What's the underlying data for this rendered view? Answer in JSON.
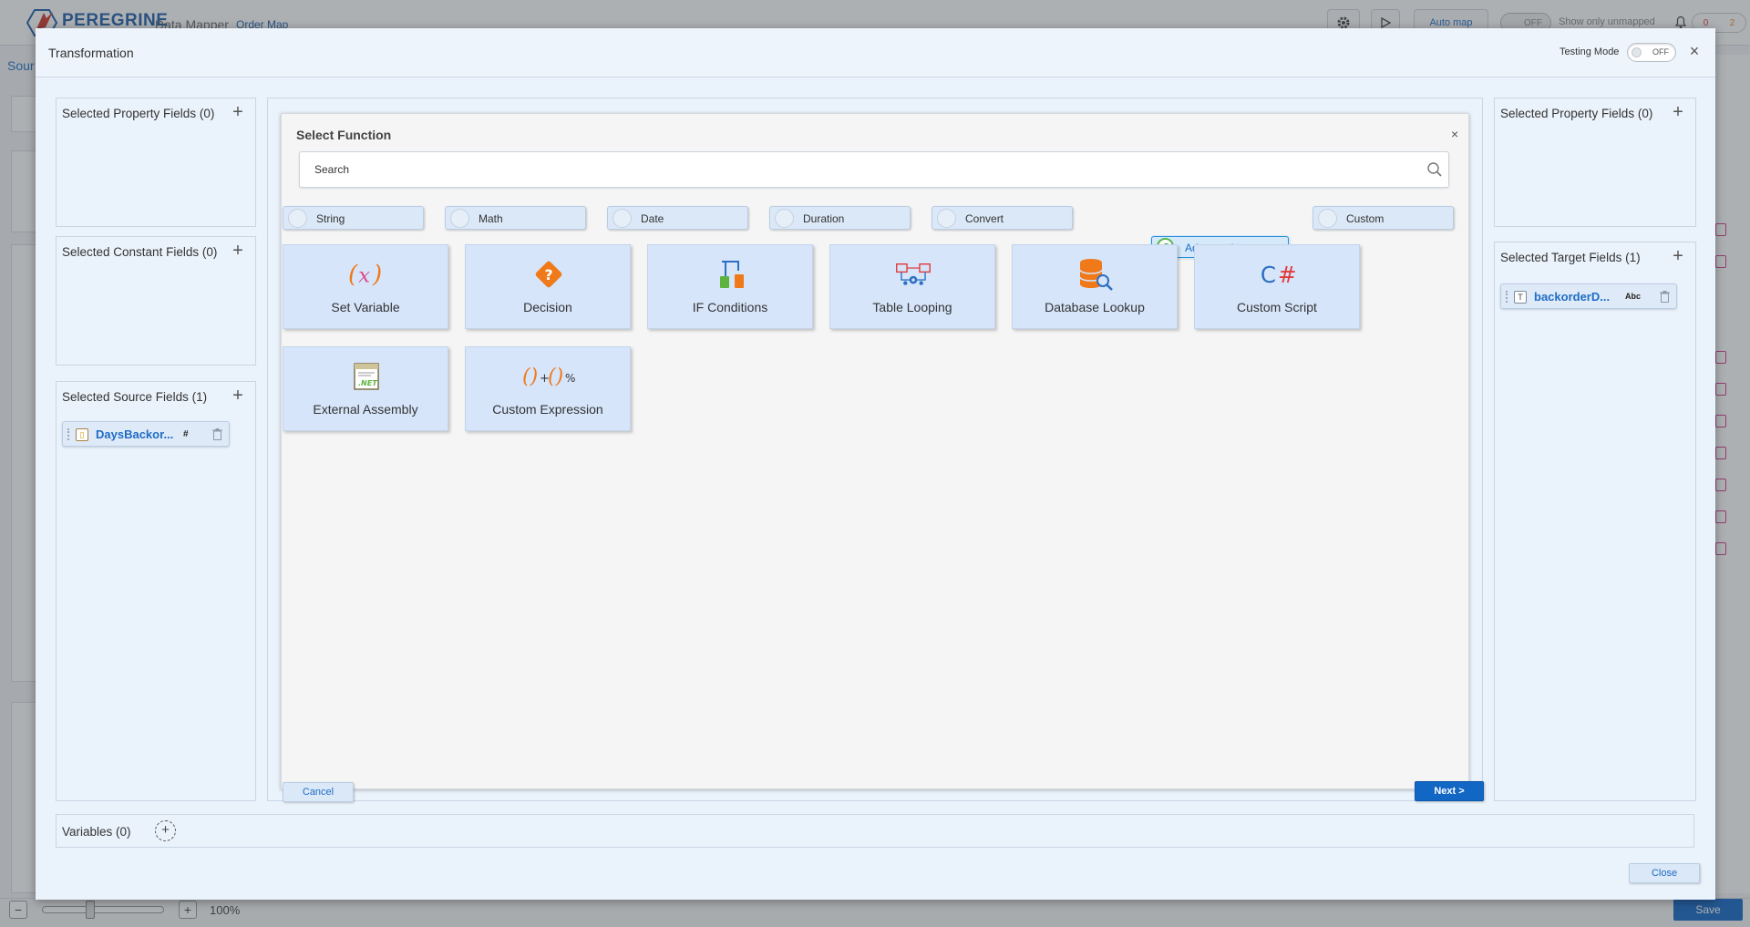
{
  "app": {
    "brand": "PEREGRINE",
    "breadcrumb_primary": "Data Mapper",
    "breadcrumb_secondary": "Order Map",
    "toolbar_automap": "Auto map",
    "toolbar_unmapped_toggle": "OFF",
    "toolbar_show_unmapped": "Show only unmapped",
    "error_count": "0",
    "warning_count": "2",
    "source_label": "Sour",
    "zoom_minus": "−",
    "zoom_plus": "+",
    "zoom_level": "100%",
    "save_label": "Save"
  },
  "modal": {
    "title": "Transformation",
    "testing_mode_label": "Testing Mode",
    "testing_mode_state": "OFF",
    "close_icon": "×",
    "close_button": "Close"
  },
  "left_panels": {
    "property_fields_title": "Selected Property Fields (0)",
    "constant_fields_title": "Selected Constant Fields (0)",
    "source_fields_title": "Selected Source Fields (1)",
    "add_icon": "+",
    "source_fields": [
      {
        "name": "DaysBackor...",
        "type_badge": "#"
      }
    ]
  },
  "right_panels": {
    "property_fields_title": "Selected Property Fields (0)",
    "target_fields_title": "Selected Target Fields (1)",
    "add_icon": "+",
    "target_fields": [
      {
        "name": "backorderD...",
        "type_badge": "Abc"
      }
    ]
  },
  "select_function": {
    "title": "Select Function",
    "close_icon": "×",
    "search_placeholder": "Search",
    "categories": [
      {
        "label": "String",
        "active": false
      },
      {
        "label": "Math",
        "active": false
      },
      {
        "label": "Date",
        "active": false
      },
      {
        "label": "Duration",
        "active": false
      },
      {
        "label": "Convert",
        "active": false
      },
      {
        "label": "Advanced",
        "active": true
      },
      {
        "label": "Custom",
        "active": false
      }
    ],
    "functions": [
      {
        "label": "Set Variable",
        "icon": "set-variable-icon"
      },
      {
        "label": "Decision",
        "icon": "decision-icon"
      },
      {
        "label": "IF Conditions",
        "icon": "if-conditions-icon"
      },
      {
        "label": "Table Looping",
        "icon": "table-looping-icon"
      },
      {
        "label": "Database Lookup",
        "icon": "database-lookup-icon"
      },
      {
        "label": "Custom Script",
        "icon": "csharp-icon"
      },
      {
        "label": "External Assembly",
        "icon": "dotnet-assembly-icon"
      },
      {
        "label": "Custom Expression",
        "icon": "custom-expression-icon"
      }
    ],
    "cancel_label": "Cancel",
    "next_label": "Next >"
  },
  "variables": {
    "title": "Variables (0)",
    "add_icon": "+"
  },
  "colors": {
    "accent": "#1266c4",
    "active_radio": "#2e9a2a",
    "tile_bg": "#d6e5fa"
  }
}
